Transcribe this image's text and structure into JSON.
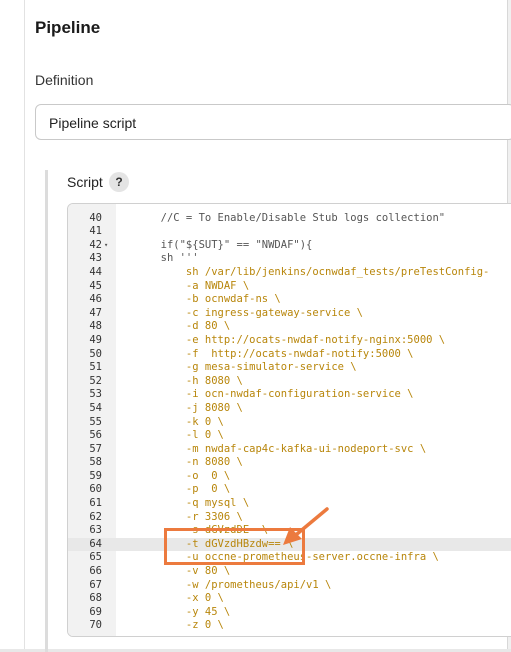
{
  "section": {
    "title": "Pipeline"
  },
  "definition": {
    "label": "Definition",
    "value": "Pipeline script"
  },
  "script": {
    "label": "Script",
    "help_icon": "?",
    "lines": [
      {
        "n": "",
        "text": "                     ",
        "kind": "cmt"
      },
      {
        "n": "40",
        "text": "  //C = To Enable/Disable Stub logs collection\"",
        "kind": "cmt"
      },
      {
        "n": "41",
        "text": "",
        "kind": "cmt"
      },
      {
        "n": "42",
        "fold": "▾",
        "text": "  if(\"${SUT}\" == \"NWDAF\"){",
        "kind": "mix"
      },
      {
        "n": "43",
        "text": "  sh '''",
        "kind": "mix"
      },
      {
        "n": "44",
        "text": "      sh /var/lib/jenkins/ocnwdaf_tests/preTestConfig-",
        "kind": "str"
      },
      {
        "n": "45",
        "text": "      -a NWDAF \\",
        "kind": "str"
      },
      {
        "n": "46",
        "text": "      -b ocnwdaf-ns \\",
        "kind": "str"
      },
      {
        "n": "47",
        "text": "      -c ingress-gateway-service \\",
        "kind": "str"
      },
      {
        "n": "48",
        "text": "      -d 80 \\",
        "kind": "str"
      },
      {
        "n": "49",
        "text": "      -e http://ocats-nwdaf-notify-nginx:5000 \\",
        "kind": "str"
      },
      {
        "n": "50",
        "text": "      -f  http://ocats-nwdaf-notify:5000 \\",
        "kind": "str"
      },
      {
        "n": "51",
        "text": "      -g mesa-simulator-service \\",
        "kind": "str"
      },
      {
        "n": "52",
        "text": "      -h 8080 \\",
        "kind": "str"
      },
      {
        "n": "53",
        "text": "      -i ocn-nwdaf-configuration-service \\",
        "kind": "str"
      },
      {
        "n": "54",
        "text": "      -j 8080 \\",
        "kind": "str"
      },
      {
        "n": "55",
        "text": "      -k 0 \\",
        "kind": "str"
      },
      {
        "n": "56",
        "text": "      -l 0 \\",
        "kind": "str"
      },
      {
        "n": "57",
        "text": "      -m nwdaf-cap4c-kafka-ui-nodeport-svc \\",
        "kind": "str"
      },
      {
        "n": "58",
        "text": "      -n 8080 \\",
        "kind": "str"
      },
      {
        "n": "59",
        "text": "      -o  0 \\",
        "kind": "str"
      },
      {
        "n": "60",
        "text": "      -p  0 \\",
        "kind": "str"
      },
      {
        "n": "61",
        "text": "      -q mysql \\",
        "kind": "str"
      },
      {
        "n": "62",
        "text": "      -r 3306 \\",
        "kind": "str"
      },
      {
        "n": "63",
        "text": "      -s dGVzdDE= \\",
        "kind": "str"
      },
      {
        "n": "64",
        "text": "      -t dGVzdHBzdw== \\",
        "kind": "str",
        "active": true
      },
      {
        "n": "65",
        "text": "      -u occne-prometheus-server.occne-infra \\",
        "kind": "str"
      },
      {
        "n": "66",
        "text": "      -v 80 \\",
        "kind": "str"
      },
      {
        "n": "67",
        "text": "      -w /prometheus/api/v1 \\",
        "kind": "str"
      },
      {
        "n": "68",
        "text": "      -x 0 \\",
        "kind": "str"
      },
      {
        "n": "69",
        "text": "      -y 45 \\",
        "kind": "str"
      },
      {
        "n": "70",
        "text": "      -z 0 \\",
        "kind": "str"
      }
    ]
  },
  "annotation": {
    "color": "#ec7a3e"
  }
}
